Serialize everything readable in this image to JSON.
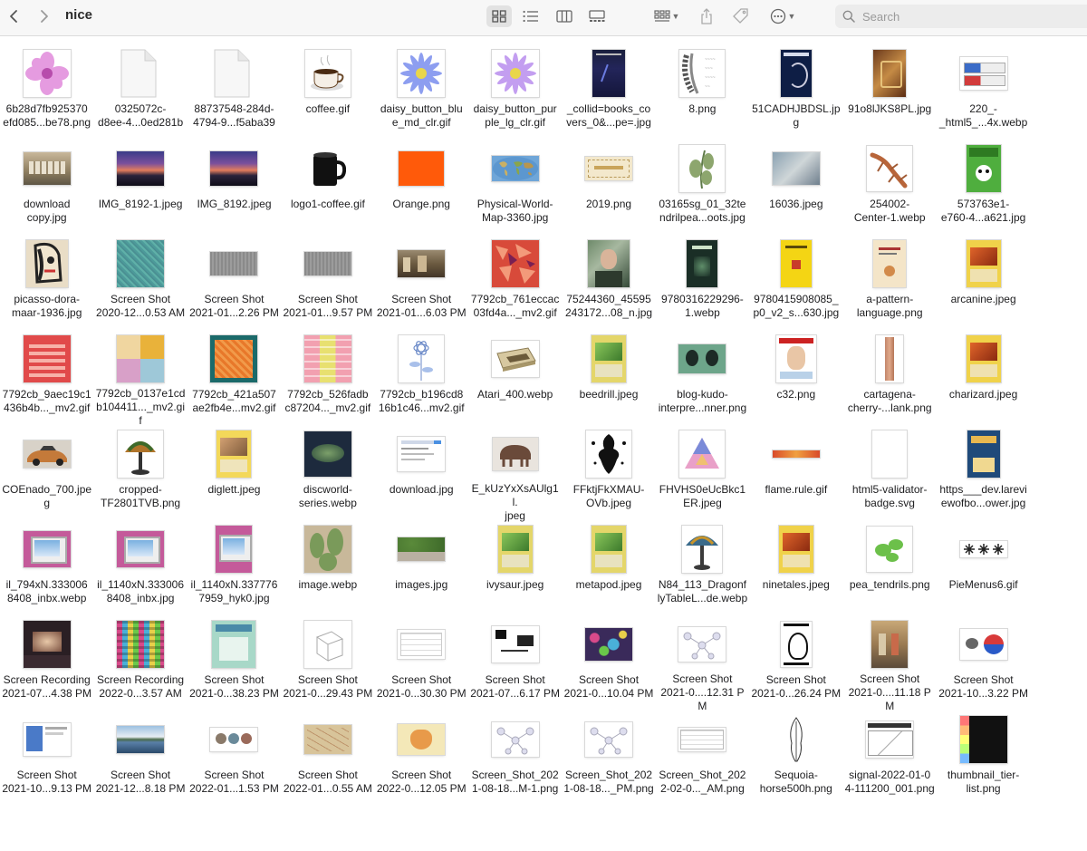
{
  "window": {
    "title": "nice",
    "nav": {
      "back_icon": "chevron-left-icon",
      "forward_icon": "chevron-right-icon"
    },
    "view_modes": [
      {
        "id": "icons",
        "icon": "icon-view-icon",
        "active": true
      },
      {
        "id": "list",
        "icon": "list-view-icon",
        "active": false
      },
      {
        "id": "columns",
        "icon": "column-view-icon",
        "active": false
      },
      {
        "id": "gallery",
        "icon": "gallery-view-icon",
        "active": false
      }
    ],
    "group_icon": "group-by-icon",
    "share_icon": "share-icon",
    "tag_icon": "tag-icon",
    "more_icon": "ellipsis-circle-icon",
    "search": {
      "placeholder": "Search",
      "value": ""
    }
  },
  "files": [
    {
      "name": "6b28d7fb925370\nefd085...be78.png",
      "thumb": "pink-flower"
    },
    {
      "name": "0325072c-\nd8ee-4...0ed281b",
      "thumb": "blank-doc"
    },
    {
      "name": "88737548-284d-\n4794-9...f5aba39",
      "thumb": "blank-doc"
    },
    {
      "name": "coffee.gif",
      "thumb": "coffee-cup"
    },
    {
      "name": "daisy_button_blu\ne_md_clr.gif",
      "thumb": "blue-flower"
    },
    {
      "name": "daisy_button_pur\nple_lg_clr.gif",
      "thumb": "purple-flower"
    },
    {
      "name": "_collid=books_co\nvers_0&...pe=.jpg",
      "thumb": "dark-book"
    },
    {
      "name": "8.png",
      "thumb": "gray-sketch"
    },
    {
      "name": "51CADHJBDSL.jp\ng",
      "thumb": "navy-book"
    },
    {
      "name": "91o8lJKS8PL.jpg",
      "thumb": "brown-book"
    },
    {
      "name": "220_-\n_html5_...4x.webp",
      "thumb": "badges"
    },
    {
      "name": "download\ncopy.jpg",
      "thumb": "photo-tan"
    },
    {
      "name": "IMG_8192-1.jpeg",
      "thumb": "sunset"
    },
    {
      "name": "IMG_8192.jpeg",
      "thumb": "sunset"
    },
    {
      "name": "logo1-coffee.gif",
      "thumb": "black-mug"
    },
    {
      "name": "Orange.png",
      "thumb": "orange"
    },
    {
      "name": "Physical-World-\nMap-3360.jpg",
      "thumb": "world-map"
    },
    {
      "name": "2019.png",
      "thumb": "ticket"
    },
    {
      "name": "03165sg_01_32te\nndrilpea...oots.jpg",
      "thumb": "pea-plant"
    },
    {
      "name": "16036.jpeg",
      "thumb": "photo-gray"
    },
    {
      "name": "254002-\nCenter-1.webp",
      "thumb": "lizard"
    },
    {
      "name": "573763e1-\ne760-4...a621.jpg",
      "thumb": "panda-book"
    },
    {
      "name": "picasso-dora-\nmaar-1936.jpg",
      "thumb": "picasso"
    },
    {
      "name": "Screen Shot\n2020-12...0.53 AM",
      "thumb": "teal-texture"
    },
    {
      "name": "Screen Shot\n2021-01...2.26 PM",
      "thumb": "gray-noise"
    },
    {
      "name": "Screen Shot\n2021-01...9.57 PM",
      "thumb": "gray-noise"
    },
    {
      "name": "Screen Shot\n2021-01...6.03 PM",
      "thumb": "photo-brown"
    },
    {
      "name": "7792cb_761eccac\n03fd4a..._mv2.gif",
      "thumb": "red-pattern"
    },
    {
      "name": "75244360_45595\n243172...08_n.jpg",
      "thumb": "portrait"
    },
    {
      "name": "9780316229296-\n1.webp",
      "thumb": "dark-green-book"
    },
    {
      "name": "9780415908085_\np0_v2_s...630.jpg",
      "thumb": "yellow-book"
    },
    {
      "name": "a-pattern-\nlanguage.png",
      "thumb": "cream-book"
    },
    {
      "name": "arcanine.jpeg",
      "thumb": "card-orange"
    },
    {
      "name": "7792cb_9aec19c1\n436b4b..._mv2.gif",
      "thumb": "red-fabric"
    },
    {
      "name": "7792cb_0137e1cd\nb104411..._mv2.gif",
      "thumb": "patchwork"
    },
    {
      "name": "7792cb_421a507\nae2fb4e...mv2.gif",
      "thumb": "orange-scarf"
    },
    {
      "name": "7792cb_526fadb\nc87204..._mv2.gif",
      "thumb": "pink-panels"
    },
    {
      "name": "7792cb_b196cd8\n16b1c46...mv2.gif",
      "thumb": "blue-drawing"
    },
    {
      "name": "Atari_400.webp",
      "thumb": "atari"
    },
    {
      "name": "beedrill.jpeg",
      "thumb": "card-green"
    },
    {
      "name": "blog-kudo-\ninterpre...nner.png",
      "thumb": "heads"
    },
    {
      "name": "c32.png",
      "thumb": "magazine"
    },
    {
      "name": "cartagena-\ncherry-...lank.png",
      "thumb": "wood-plank"
    },
    {
      "name": "charizard.jpeg",
      "thumb": "card-orange"
    },
    {
      "name": "COEnado_700.jpe\ng",
      "thumb": "car"
    },
    {
      "name": "cropped-\nTF2801TVB.png",
      "thumb": "lamp"
    },
    {
      "name": "diglett.jpeg",
      "thumb": "card-yellow"
    },
    {
      "name": "discworld-\nseries.webp",
      "thumb": "discworld"
    },
    {
      "name": "download.jpg",
      "thumb": "web-page"
    },
    {
      "name": "E_kUzYxXsAUlg1l.\njpeg",
      "thumb": "pig-statue"
    },
    {
      "name": "FFktjFkXMAU-\nOVb.jpeg",
      "thumb": "ink-blot"
    },
    {
      "name": "FHVHS0eUcBkc1\nER.jpeg",
      "thumb": "triangle"
    },
    {
      "name": "flame.rule.gif",
      "thumb": "flame-rule"
    },
    {
      "name": "html5-validator-\nbadge.svg",
      "thumb": "blank-page"
    },
    {
      "name": "https___dev.larevi\newofbo...ower.jpg",
      "thumb": "butler-book"
    },
    {
      "name": "il_794xN.333006\n8408_inbx.webp",
      "thumb": "monitor"
    },
    {
      "name": "il_1140xN.333006\n8408_inbx.jpg",
      "thumb": "monitor"
    },
    {
      "name": "il_1140xN.337776\n7959_hyk0.jpg",
      "thumb": "monitor-tall"
    },
    {
      "name": "image.webp",
      "thumb": "cactus"
    },
    {
      "name": "images.jpg",
      "thumb": "ivy-wall"
    },
    {
      "name": "ivysaur.jpeg",
      "thumb": "card-green"
    },
    {
      "name": "metapod.jpeg",
      "thumb": "card-green"
    },
    {
      "name": "N84_113_Dragonf\nlyTableL...de.webp",
      "thumb": "tiffany"
    },
    {
      "name": "ninetales.jpeg",
      "thumb": "card-orange"
    },
    {
      "name": "pea_tendrils.png",
      "thumb": "pea-tendril"
    },
    {
      "name": "PieMenus6.gif",
      "thumb": "pie-menus"
    },
    {
      "name": "Screen Recording\n2021-07...4.38 PM",
      "thumb": "recording"
    },
    {
      "name": "Screen Recording\n2022-0...3.57 AM",
      "thumb": "color-grid"
    },
    {
      "name": "Screen Shot\n2021-0...38.23 PM",
      "thumb": "teal-card"
    },
    {
      "name": "Screen Shot\n2021-0...29.43 PM",
      "thumb": "cube-sketch"
    },
    {
      "name": "Screen Shot\n2021-0...30.30 PM",
      "thumb": "wireframe"
    },
    {
      "name": "Screen Shot\n2021-07...6.17 PM",
      "thumb": "bw-layout"
    },
    {
      "name": "Screen Shot\n2021-0...10.04 PM",
      "thumb": "dots-collage"
    },
    {
      "name": "Screen Shot\n2021-0....12.31 PM",
      "thumb": "node-graph"
    },
    {
      "name": "Screen Shot\n2021-0...26.24 PM",
      "thumb": "scroll-art"
    },
    {
      "name": "Screen Shot\n2021-0....11.18 PM",
      "thumb": "painting"
    },
    {
      "name": "Screen Shot\n2021-10...3.22 PM",
      "thumb": "diagram-red-blue"
    },
    {
      "name": "Screen Shot\n2021-10...9.13 PM",
      "thumb": "app-ui"
    },
    {
      "name": "Screen Shot\n2021-12...8.18 PM",
      "thumb": "lake"
    },
    {
      "name": "Screen Shot\n2022-01...1.53 PM",
      "thumb": "three-circles"
    },
    {
      "name": "Screen Shot\n2022-01...0.55 AM",
      "thumb": "old-map"
    },
    {
      "name": "Screen Shot\n2022-0...12.05 PM",
      "thumb": "tulip"
    },
    {
      "name": "Screen_Shot_202\n1-08-18...M-1.png",
      "thumb": "node-graph"
    },
    {
      "name": "Screen_Shot_202\n1-08-18..._PM.png",
      "thumb": "node-graph"
    },
    {
      "name": "Screen_Shot_202\n2-02-0..._AM.png",
      "thumb": "sheet"
    },
    {
      "name": "Sequoia-\nhorse500h.png",
      "thumb": "tree"
    },
    {
      "name": "signal-2022-01-0\n4-111200_001.png",
      "thumb": "signal"
    },
    {
      "name": "thumbnail_tier-\nlist.png",
      "thumb": "tier-list"
    }
  ]
}
